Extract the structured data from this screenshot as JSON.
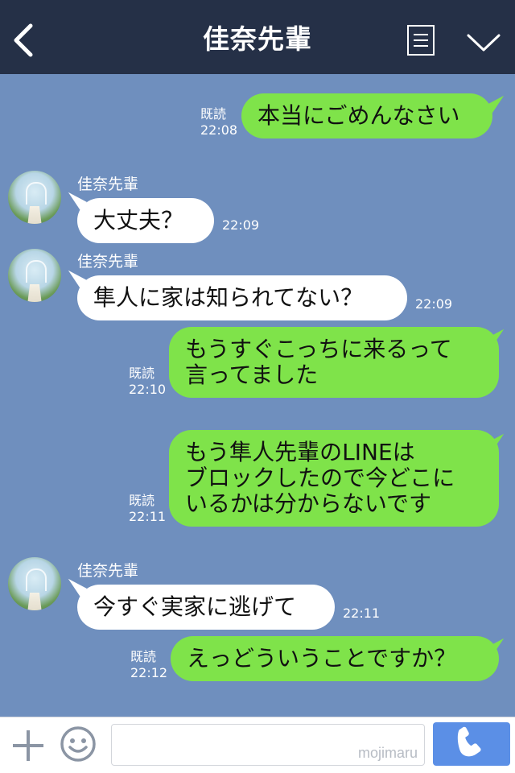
{
  "header": {
    "title": "佳奈先輩"
  },
  "icons": {
    "back": "chevron-left-icon",
    "menu": "list-icon",
    "collapse": "chevron-down-icon",
    "add": "plus-icon",
    "emoji": "smiley-icon",
    "call": "phone-icon"
  },
  "messages": [
    {
      "from": "me",
      "text": "本当にごめんなさい",
      "read": "既読",
      "time": "22:08"
    },
    {
      "from": "佳奈先輩",
      "sender": "佳奈先輩",
      "text": "大丈夫？",
      "time": "22:09"
    },
    {
      "from": "佳奈先輩",
      "sender": "佳奈先輩",
      "text": "隼人に家は知られてない？",
      "time": "22:09"
    },
    {
      "from": "me",
      "lines": [
        "もうすぐこっちに来るって",
        "言ってました"
      ],
      "read": "既読",
      "time": "22:10"
    },
    {
      "from": "me",
      "lines": [
        "もう隼人先輩のLINEは",
        "ブロックしたので今どこに",
        "いるかは分からないです"
      ],
      "read": "既読",
      "time": "22:11"
    },
    {
      "from": "佳奈先輩",
      "sender": "佳奈先輩",
      "text": "今すぐ実家に逃げて",
      "time": "22:11"
    },
    {
      "from": "me",
      "text": "えっどういうことですか？",
      "read": "既読",
      "time": "22:12"
    }
  ],
  "footer": {
    "input_value": "",
    "watermark": "mojimaru"
  },
  "colors": {
    "header_bg": "#253047",
    "chat_bg": "#6f8fbe",
    "my_bubble": "#7fe34a",
    "their_bubble": "#ffffff",
    "call_button": "#5b8fe6"
  }
}
